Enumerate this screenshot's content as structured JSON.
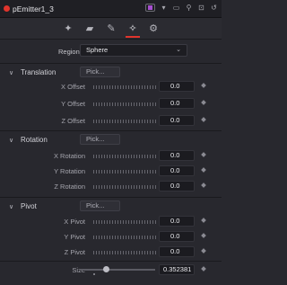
{
  "header": {
    "title": "pEmitter1_3",
    "accent_color": "#e0342c",
    "swatch_color": "#a74fd0",
    "icons": [
      "color-swatch-icon",
      "dropdown-icon",
      "window-icon",
      "pin-icon",
      "lock-icon",
      "reset-icon"
    ]
  },
  "tabs": [
    {
      "name": "tab-controls",
      "icon": "emitter-icon"
    },
    {
      "name": "tab-style",
      "icon": "style-icon"
    },
    {
      "name": "tab-brush",
      "icon": "brush-icon"
    },
    {
      "name": "tab-region",
      "icon": "region-icon",
      "active": true
    },
    {
      "name": "tab-settings",
      "icon": "settings-icon"
    }
  ],
  "region": {
    "label": "Region",
    "value": "Sphere"
  },
  "sections": {
    "translation": {
      "title": "Translation",
      "pick": "Pick...",
      "rows": [
        {
          "label": "X Offset",
          "value": "0.0"
        },
        {
          "label": "Y Offset",
          "value": "0.0"
        },
        {
          "label": "Z Offset",
          "value": "0.0"
        }
      ]
    },
    "rotation": {
      "title": "Rotation",
      "pick": "Pick...",
      "rows": [
        {
          "label": "X Rotation",
          "value": "0.0"
        },
        {
          "label": "Y Rotation",
          "value": "0.0"
        },
        {
          "label": "Z Rotation",
          "value": "0.0"
        }
      ]
    },
    "pivot": {
      "title": "Pivot",
      "pick": "Pick...",
      "rows": [
        {
          "label": "X Pivot",
          "value": "0.0"
        },
        {
          "label": "Y Pivot",
          "value": "0.0"
        },
        {
          "label": "Z Pivot",
          "value": "0.0"
        }
      ]
    }
  },
  "size": {
    "label": "Size",
    "value": "0.352381",
    "slider_fraction": 0.35
  }
}
